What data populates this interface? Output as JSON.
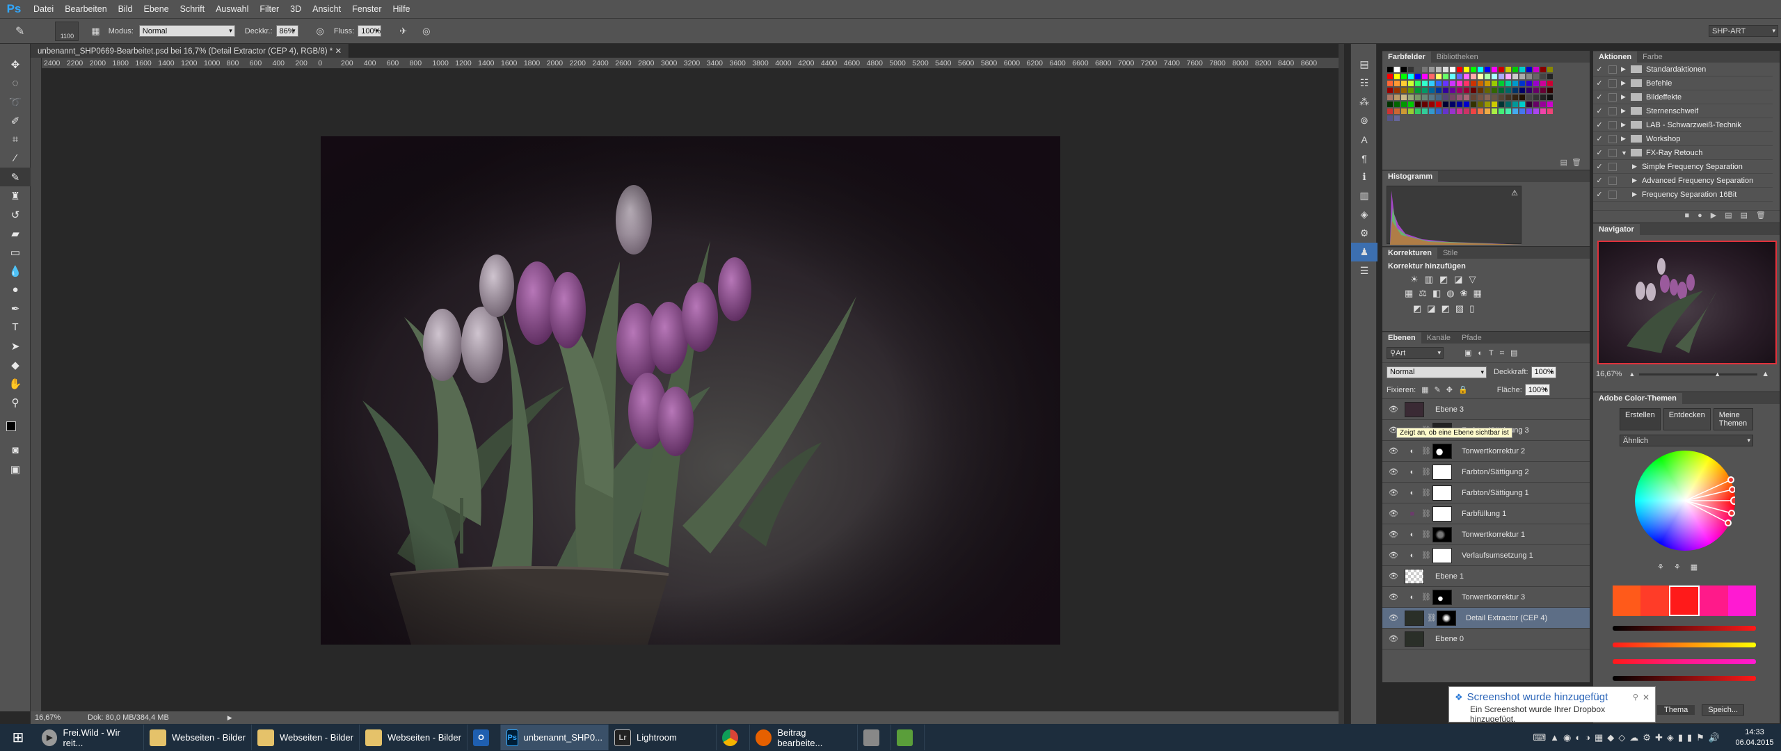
{
  "menu": {
    "logo": "Ps",
    "items": [
      "Datei",
      "Bearbeiten",
      "Bild",
      "Ebene",
      "Schrift",
      "Auswahl",
      "Filter",
      "3D",
      "Ansicht",
      "Fenster",
      "Hilfe"
    ]
  },
  "options": {
    "brush_size": "1100",
    "mode_label": "Modus:",
    "mode_value": "Normal",
    "opacity_label": "Deckkr.:",
    "opacity_value": "86%",
    "flow_label": "Fluss:",
    "flow_value": "100%",
    "workspace": "SHP-ART"
  },
  "document": {
    "tab_title": "unbenannt_SHP0669-Bearbeitet.psd bei 16,7% (Detail Extractor (CEP 4), RGB/8) *",
    "zoom": "16,67%",
    "doc_size": "Dok: 80,0 MB/384,4 MB"
  },
  "ruler_labels": [
    "2400",
    "2200",
    "2000",
    "1800",
    "1600",
    "1400",
    "1200",
    "1000",
    "800",
    "600",
    "400",
    "200",
    "0",
    "200",
    "400",
    "600",
    "800",
    "1000",
    "1200",
    "1400",
    "1600",
    "1800",
    "2000",
    "2200",
    "2400",
    "2600",
    "2800",
    "3000",
    "3200",
    "3400",
    "3600",
    "3800",
    "4000",
    "4200",
    "4400",
    "4600",
    "4800",
    "5000",
    "5200",
    "5400",
    "5600",
    "5800",
    "6000",
    "6200",
    "6400",
    "6600",
    "6800",
    "7000",
    "7200",
    "7400",
    "7600",
    "7800",
    "8000",
    "8200",
    "8400",
    "8600"
  ],
  "swatches_panel": {
    "tabs": [
      "Farbfelder",
      "Bibliotheken"
    ]
  },
  "histogram_panel": {
    "title": "Histogramm"
  },
  "adjust_panel": {
    "tabs": [
      "Korrekturen",
      "Stile"
    ],
    "heading": "Korrektur hinzufügen"
  },
  "layers_panel": {
    "tabs": [
      "Ebenen",
      "Kanäle",
      "Pfade"
    ],
    "filter_label": "Art",
    "blend_mode": "Normal",
    "opacity_label": "Deckkraft:",
    "opacity_value": "100%",
    "lock_label": "Fixieren:",
    "fill_label": "Fläche:",
    "fill_value": "100%",
    "tooltip": "Zeigt an, ob eine Ebene sichtbar ist",
    "layers": [
      {
        "name": "Ebene 3"
      },
      {
        "name": "Farbton/Sättigung 3"
      },
      {
        "name": "Tonwertkorrektur 2"
      },
      {
        "name": "Farbton/Sättigung 2"
      },
      {
        "name": "Farbton/Sättigung 1"
      },
      {
        "name": "Farbfüllung 1"
      },
      {
        "name": "Tonwertkorrektur 1"
      },
      {
        "name": "Verlaufsumsetzung 1"
      },
      {
        "name": "Ebene 1"
      },
      {
        "name": "Tonwertkorrektur 3"
      },
      {
        "name": "Detail Extractor (CEP 4)"
      },
      {
        "name": "Ebene 0"
      }
    ]
  },
  "actions_panel": {
    "tabs": [
      "Aktionen",
      "Farbe"
    ],
    "items": [
      "Standardaktionen",
      "Befehle",
      "Bildeffekte",
      "Sternenschweif",
      "LAB - Schwarzweiß-Technik",
      "Workshop",
      "FX-Ray Retouch",
      "Simple Frequency Separation",
      "Advanced Frequency Separation",
      "Frequency Separation 16Bit"
    ]
  },
  "navigator_panel": {
    "title": "Navigator",
    "zoom": "16,67%"
  },
  "color_themes": {
    "title": "Adobe Color-Themen",
    "tabs": [
      "Erstellen",
      "Entdecken",
      "Meine Themen"
    ],
    "rule": "Ähnlich",
    "swatches": [
      "#ff5a1a",
      "#ff3c28",
      "#ff1a1a",
      "#ff1a8a",
      "#ff1ad2"
    ],
    "bottom_tab": "Thema",
    "save": "Speich..."
  },
  "notification": {
    "title": "Screenshot wurde hinzugefügt",
    "body": "Ein Screenshot wurde Ihrer Dropbox hinzugefügt."
  },
  "taskbar": {
    "items": [
      "Frei.Wild - Wir reit...",
      "Webseiten - Bilder",
      "Webseiten - Bilder",
      "Webseiten - Bilder",
      "unbenannt_SHP0...",
      "Lightroom",
      "Beitrag bearbeite..."
    ],
    "time": "14:33",
    "date": "06.04.2015"
  }
}
